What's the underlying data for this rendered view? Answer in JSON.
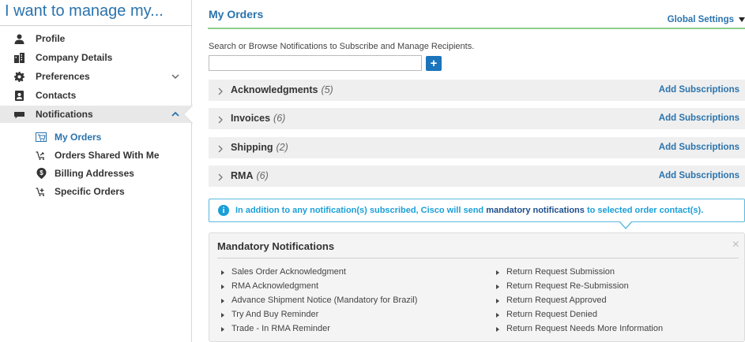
{
  "sidebar": {
    "title": "I want to manage my...",
    "items": [
      {
        "label": "Profile",
        "icon": "user-icon"
      },
      {
        "label": "Company Details",
        "icon": "building-icon"
      },
      {
        "label": "Preferences",
        "icon": "gear-icon",
        "expandable": true
      },
      {
        "label": "Contacts",
        "icon": "address-book-icon"
      },
      {
        "label": "Notifications",
        "icon": "comment-icon",
        "expanded": true
      }
    ],
    "sub_items": [
      {
        "label": "My Orders",
        "icon": "cart-icon"
      },
      {
        "label": "Orders Shared With Me",
        "icon": "shared-cart-icon"
      },
      {
        "label": "Billing Addresses",
        "icon": "dollar-icon"
      },
      {
        "label": "Specific Orders",
        "icon": "cart-plus-icon"
      }
    ]
  },
  "main": {
    "title": "My Orders",
    "global_settings": "Global Settings",
    "search_hint": "Search or Browse Notifications to Subscribe and Manage Recipients.",
    "search_value": "",
    "add_button": "+",
    "categories": [
      {
        "label": "Acknowledgments",
        "count": "(5)",
        "action": "Add Subscriptions"
      },
      {
        "label": "Invoices",
        "count": "(6)",
        "action": "Add Subscriptions"
      },
      {
        "label": "Shipping",
        "count": "(2)",
        "action": "Add Subscriptions"
      },
      {
        "label": "RMA",
        "count": "(6)",
        "action": "Add Subscriptions"
      }
    ],
    "info": {
      "icon_glyph": "i",
      "text_before": "In addition to any notification(s) subscribed, Cisco will send ",
      "text_emphasis": "mandatory notifications",
      "text_after": " to selected order contact(s)."
    },
    "mandatory": {
      "title": "Mandatory Notifications",
      "close": "×",
      "left_items": [
        "Sales Order Acknowledgment",
        "RMA Acknowledgment",
        "Advance Shipment Notice (Mandatory for Brazil)",
        "Try And Buy Reminder",
        "Trade - In RMA Reminder"
      ],
      "right_items": [
        "Return Request Submission",
        "Return Request Re-Submission",
        "Return Request Approved",
        "Return Request Denied",
        "Return Request Needs More Information"
      ]
    }
  },
  "colors": {
    "accent_blue": "#2a73ad",
    "info_blue": "#1a9fd8",
    "green_rule": "#8ccf8a",
    "row_bg": "#efefef"
  }
}
